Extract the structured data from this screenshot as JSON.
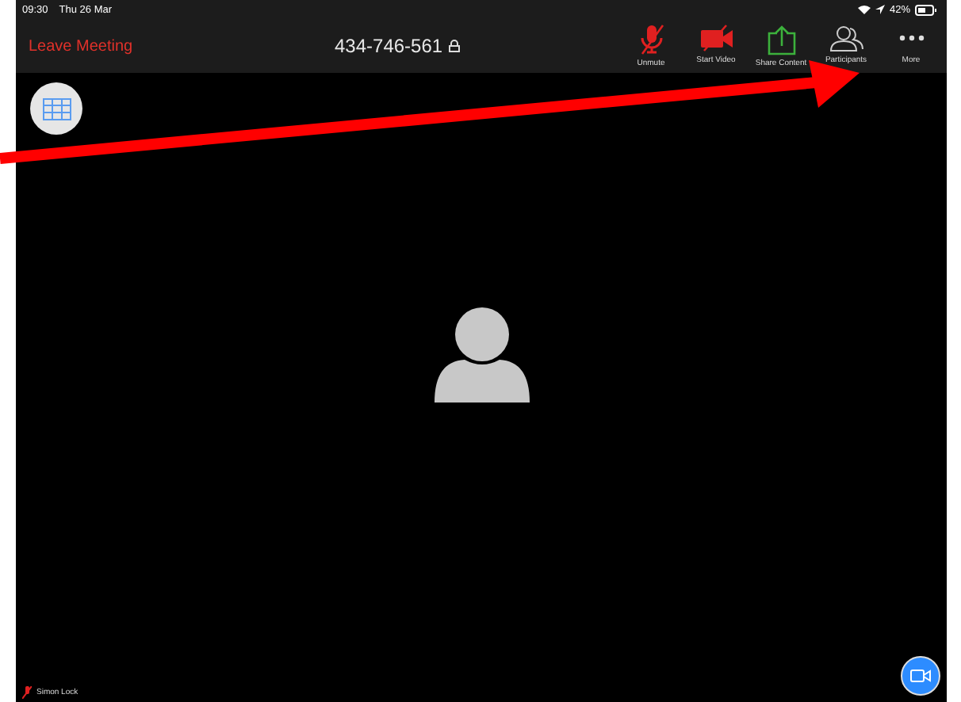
{
  "status_bar": {
    "time": "09:30",
    "date": "Thu 26 Mar",
    "battery": "42%"
  },
  "header": {
    "leave": "Leave Meeting",
    "meeting_id": "434-746-561"
  },
  "toolbar": [
    {
      "kind": "mic",
      "label": "Unmute"
    },
    {
      "kind": "video",
      "label": "Start Video"
    },
    {
      "kind": "share",
      "label": "Share Content"
    },
    {
      "kind": "participants",
      "label": "Participants"
    },
    {
      "kind": "more",
      "label": "More"
    }
  ],
  "participant": {
    "name": "Simon Lock",
    "muted": true
  }
}
